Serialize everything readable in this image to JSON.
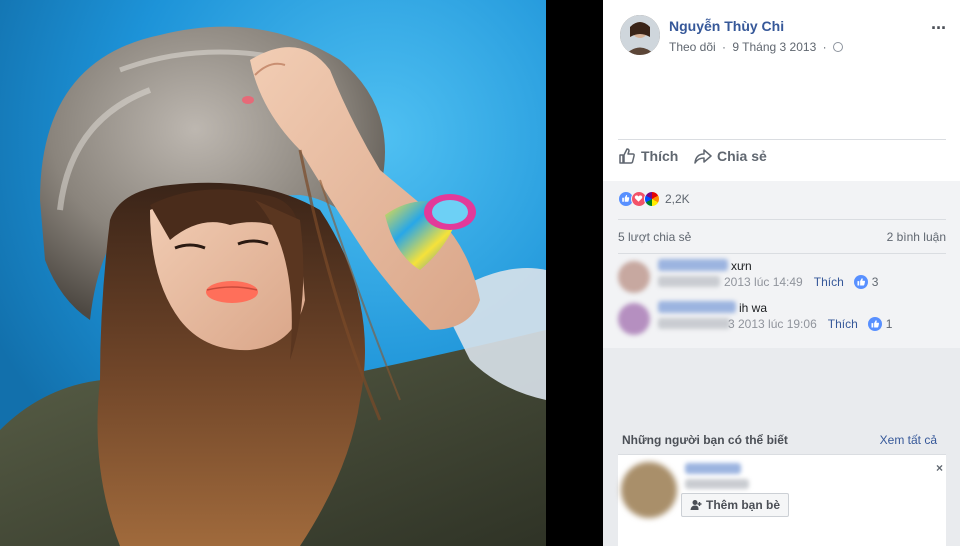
{
  "photo": {
    "icon": "photo-portrait"
  },
  "post": {
    "author": "Nguyễn Thùy Chi",
    "follow": "Theo dõi",
    "date": "9 Tháng 3 2013",
    "sep": "·",
    "privacy_icon": "globe-icon",
    "more": "···"
  },
  "actions": {
    "like": "Thích",
    "share": "Chia sẻ"
  },
  "reactions": {
    "types": [
      "like",
      "love",
      "pride"
    ],
    "count": "2,2K"
  },
  "stats": {
    "shares": "5 lượt chia sẻ",
    "comments": "2 bình luận"
  },
  "comments": [
    {
      "text": "xưn",
      "date": "2013 lúc 14:49",
      "like": "Thích",
      "likes": "3"
    },
    {
      "text": "ih wa",
      "date": "29 Tháng 3 2013 lúc 19:06",
      "date_visible": "3 2013 lúc 19:06",
      "like": "Thích",
      "likes": "1"
    }
  ],
  "pymk": {
    "title": "Những người bạn có thể biết",
    "see_all": "Xem tất cả",
    "add_friend": "Thêm bạn bè",
    "close": "×"
  },
  "colors": {
    "link": "#365899",
    "like_blue": "#5890ff",
    "love": "#f25268",
    "bg": "#e9ebee"
  }
}
